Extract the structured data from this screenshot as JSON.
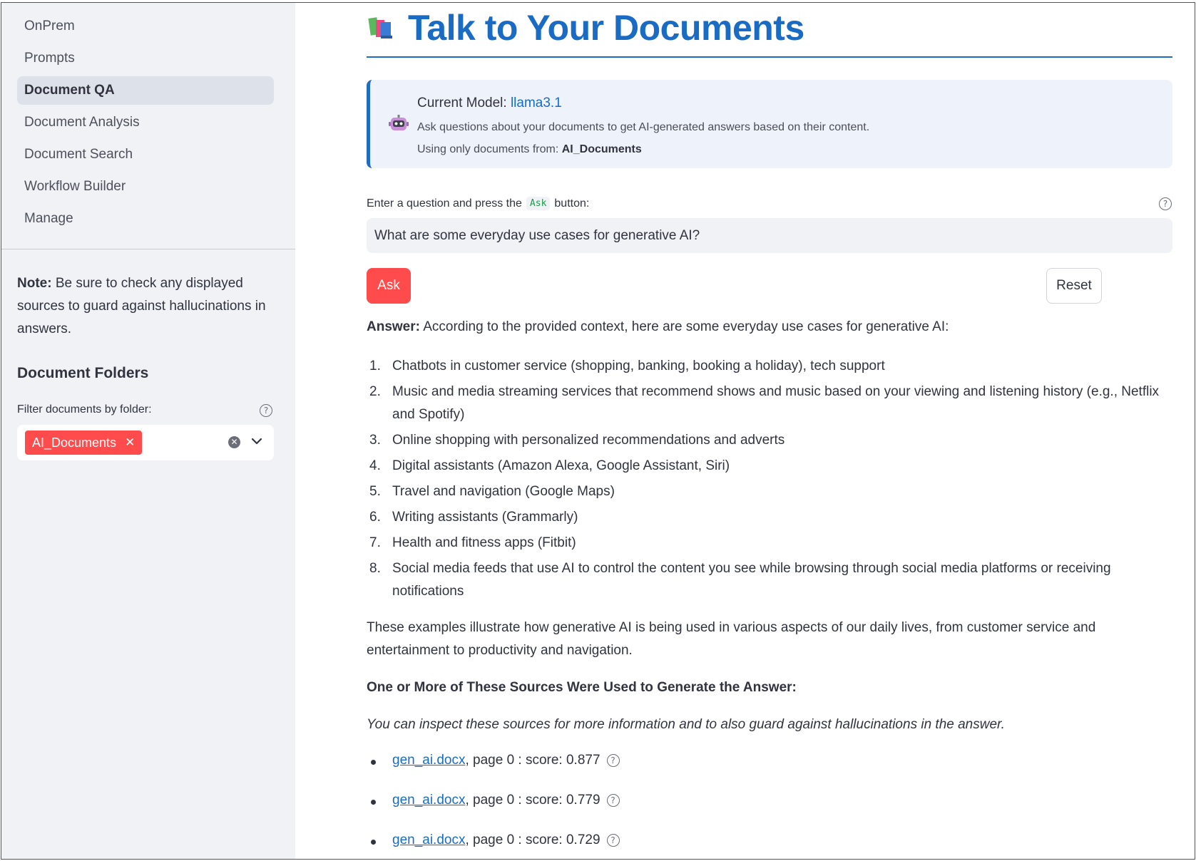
{
  "sidebar": {
    "nav": [
      {
        "label": "OnPrem",
        "active": false
      },
      {
        "label": "Prompts",
        "active": false
      },
      {
        "label": "Document QA",
        "active": true
      },
      {
        "label": "Document Analysis",
        "active": false
      },
      {
        "label": "Document Search",
        "active": false
      },
      {
        "label": "Workflow Builder",
        "active": false
      },
      {
        "label": "Manage",
        "active": false
      }
    ],
    "note_label": "Note:",
    "note_text": " Be sure to check any displayed sources to guard against hallucinations in answers.",
    "folders_heading": "Document Folders",
    "filter_label": "Filter documents by folder:",
    "selected_folder": "AI_Documents"
  },
  "main": {
    "title": "Talk to Your Documents",
    "info": {
      "model_label": "Current Model: ",
      "model_value": "llama3.1",
      "description": "Ask questions about your documents to get AI-generated answers based on their content.",
      "folder_prefix": "Using only documents from: ",
      "folder_value": "AI_Documents"
    },
    "question": {
      "label_before": "Enter a question and press the",
      "label_code": "Ask",
      "label_after": "button:",
      "value": "What are some everyday use cases for generative AI?"
    },
    "ask_label": "Ask",
    "reset_label": "Reset",
    "answer": {
      "label": "Answer:",
      "intro": " According to the provided context, here are some everyday use cases for generative AI:",
      "items": [
        "Chatbots in customer service (shopping, banking, booking a holiday), tech support",
        "Music and media streaming services that recommend shows and music based on your viewing and listening history (e.g., Netflix and Spotify)",
        "Online shopping with personalized recommendations and adverts",
        "Digital assistants (Amazon Alexa, Google Assistant, Siri)",
        "Travel and navigation (Google Maps)",
        "Writing assistants (Grammarly)",
        "Health and fitness apps (Fitbit)",
        "Social media feeds that use AI to control the content you see while browsing through social media platforms or receiving notifications"
      ],
      "summary": "These examples illustrate how generative AI is being used in various aspects of our daily lives, from customer service and entertainment to productivity and navigation."
    },
    "sources_heading": "One or More of These Sources Were Used to Generate the Answer:",
    "sources_note": "You can inspect these sources for more information and to also guard against hallucinations in the answer.",
    "sources": [
      {
        "file": "gen_ai.docx",
        "detail": ", page 0 : score: 0.877"
      },
      {
        "file": "gen_ai.docx",
        "detail": ", page 0 : score: 0.779"
      },
      {
        "file": "gen_ai.docx",
        "detail": ", page 0 : score: 0.729"
      }
    ]
  }
}
